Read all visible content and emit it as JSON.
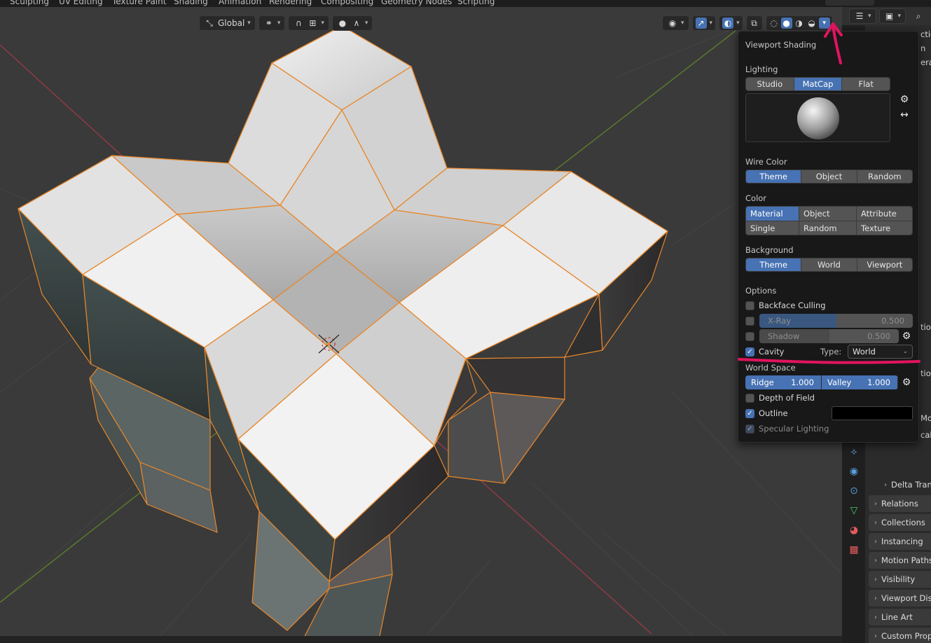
{
  "workspace_tabs": [
    "Sculpting",
    "UV Editing",
    "Texture Paint",
    "Shading",
    "Animation",
    "Rendering",
    "Compositing",
    "Geometry Nodes",
    "Scripting"
  ],
  "header": {
    "orientation": "Global",
    "shading_mode_icons": [
      "wireframe-shading-icon",
      "solid-shading-icon",
      "material-preview-icon",
      "rendered-shading-icon"
    ]
  },
  "popover": {
    "title": "Viewport Shading",
    "lighting": {
      "label": "Lighting",
      "options": [
        "Studio",
        "MatCap",
        "Flat"
      ],
      "selected": "MatCap"
    },
    "wire_color": {
      "label": "Wire Color",
      "options": [
        "Theme",
        "Object",
        "Random"
      ],
      "selected": "Theme"
    },
    "color": {
      "label": "Color",
      "options": [
        "Material",
        "Object",
        "Attribute",
        "Single",
        "Random",
        "Texture"
      ],
      "selected": "Material"
    },
    "background": {
      "label": "Background",
      "options": [
        "Theme",
        "World",
        "Viewport"
      ],
      "selected": "Theme"
    },
    "options": {
      "label": "Options",
      "backface_culling": {
        "label": "Backface Culling",
        "checked": false
      },
      "xray": {
        "label": "X-Ray",
        "value": "0.500",
        "fraction": 0.5,
        "checked": false
      },
      "shadow": {
        "label": "Shadow",
        "value": "0.500",
        "fraction": 0.5,
        "checked": false
      },
      "cavity": {
        "label": "Cavity",
        "checked": true,
        "type_label": "Type:",
        "type_value": "World"
      },
      "world_space": {
        "label": "World Space",
        "ridge_label": "Ridge",
        "ridge_value": "1.000",
        "valley_label": "Valley",
        "valley_value": "1.000"
      },
      "depth_of_field": {
        "label": "Depth of Field",
        "checked": false
      },
      "outline": {
        "label": "Outline",
        "checked": true,
        "color": "#000000"
      },
      "specular": {
        "label": "Specular Lighting",
        "checked": true
      }
    }
  },
  "properties": {
    "partial_labels": [
      "ction",
      "n",
      "era",
      "tion",
      "tion",
      "Mo",
      "cale"
    ],
    "panels": [
      "Delta Tran",
      "Relations",
      "Collections",
      "Instancing",
      "Motion Paths",
      "Visibility",
      "Viewport Dis",
      "Line Art",
      "Custom Prop"
    ]
  },
  "colors": {
    "accent": "#4772b3",
    "selection": "#e8872a",
    "annotation": "#e0145f"
  }
}
